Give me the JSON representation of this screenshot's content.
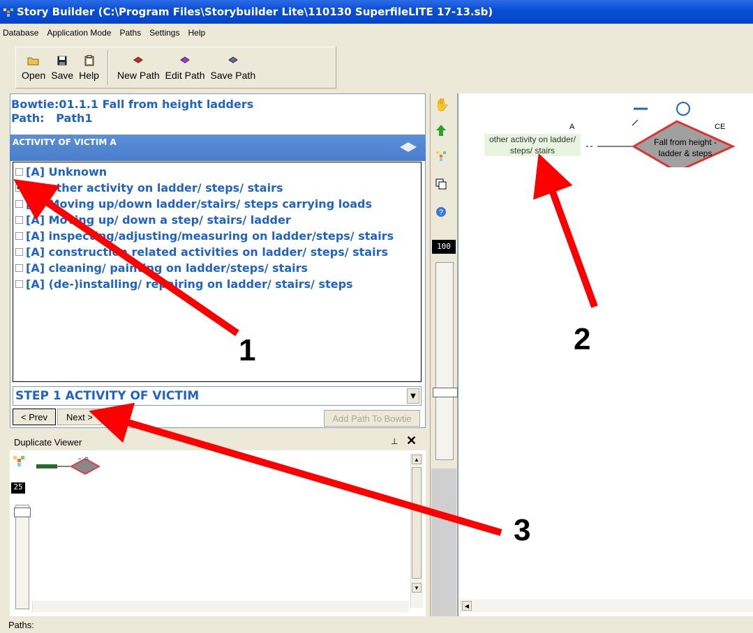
{
  "window": {
    "title": "Story Builder (C:\\Program Files\\Storybuilder Lite\\110130 SuperfileLITE 17-13.sb)"
  },
  "menu": [
    "Database",
    "Application Mode",
    "Paths",
    "Settings",
    "Help"
  ],
  "toolbar": {
    "open": "Open",
    "save": "Save",
    "help": "Help",
    "new_path": "New Path",
    "edit_path": "Edit Path",
    "save_path": "Save Path"
  },
  "header": {
    "bowtie": "Bowtie:01.1.1 Fall from height ladders",
    "path_label": "Path:",
    "path_value": "Path1"
  },
  "section": {
    "title": "ACTIVITY OF VICTIM A"
  },
  "activities": [
    {
      "label": "[A] Unknown",
      "checked": false
    },
    {
      "label": "[A] other activity on ladder/ steps/ stairs",
      "checked": true
    },
    {
      "label": "[A] Moving up/down ladder/stairs/ steps carrying loads",
      "checked": false
    },
    {
      "label": "[A] Moving up/ down a step/ stairs/ ladder",
      "checked": false
    },
    {
      "label": "[A] inspecting/adjusting/measuring on ladder/steps/ stairs",
      "checked": false
    },
    {
      "label": "[A] construction related activities on ladder/ steps/ stairs",
      "checked": false
    },
    {
      "label": "[A] cleaning/ painting on ladder/steps/ stairs",
      "checked": false
    },
    {
      "label": "[A] (de-)installing/ repairing on ladder/ stairs/ steps",
      "checked": false
    }
  ],
  "step": {
    "selected": "STEP 1 ACTIVITY OF VICTIM"
  },
  "nav": {
    "prev": "< Prev",
    "next": "Next >",
    "add_path": "Add Path To Bowtie"
  },
  "duplicate_viewer": {
    "title": "Duplicate Viewer",
    "pin": "\u0004",
    "close": "✕",
    "zoom": "25"
  },
  "side_tools": {
    "zoom": "100"
  },
  "diagram": {
    "node_a": {
      "tag": "A",
      "text": "other activity on ladder/ steps/ stairs"
    },
    "node_ce": {
      "tag": "CE",
      "text": "Fall from height - ladder & steps"
    }
  },
  "annotations": [
    "1",
    "2",
    "3"
  ],
  "statusbar": {
    "text": "Paths:"
  },
  "colors": {
    "accent_text": "#1e64c8",
    "arrow": "#ff0000",
    "title_bar": "#0a4fd6",
    "section_bar": "#4a7ecc"
  }
}
